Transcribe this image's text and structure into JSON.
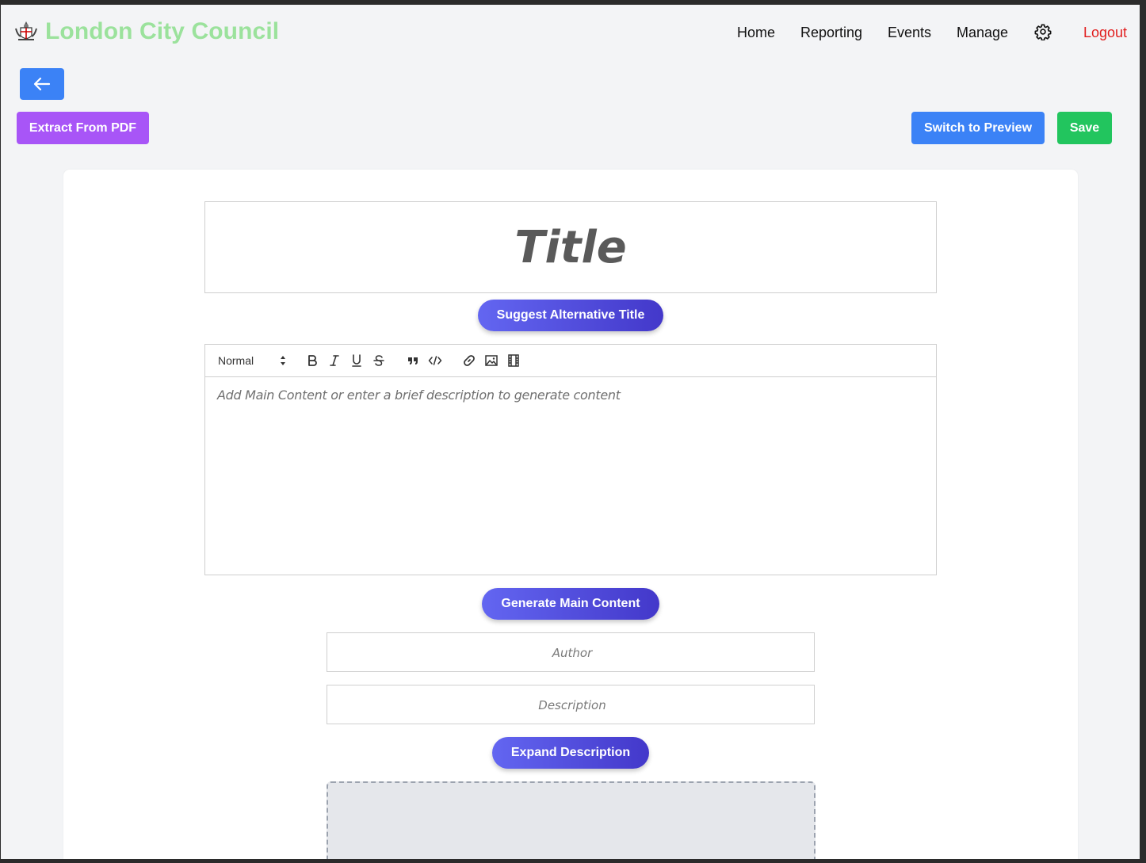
{
  "header": {
    "brand": "London City Council",
    "nav": [
      "Home",
      "Reporting",
      "Events",
      "Manage"
    ],
    "logout": "Logout"
  },
  "toolbar_top": {
    "extract_pdf": "Extract From PDF",
    "switch_preview": "Switch to Preview",
    "save": "Save"
  },
  "editor": {
    "title_placeholder": "Title",
    "suggest_title": "Suggest Alternative Title",
    "format_select": "Normal",
    "content_placeholder": "Add Main Content or enter a brief description to generate content",
    "generate_content": "Generate Main Content",
    "author_placeholder": "Author",
    "description_placeholder": "Description",
    "expand_description": "Expand Description"
  },
  "colors": {
    "brand": "#9be29c",
    "primary": "#3b82f6",
    "purple": "#a855f7",
    "green": "#22c55e",
    "indigo": "#4f46e5",
    "logout": "#e11d1d"
  },
  "icons": [
    "crest-logo",
    "gear-icon",
    "arrow-left-icon",
    "bold-icon",
    "italic-icon",
    "underline-icon",
    "strike-icon",
    "quote-icon",
    "code-icon",
    "link-icon",
    "image-icon",
    "video-icon"
  ]
}
